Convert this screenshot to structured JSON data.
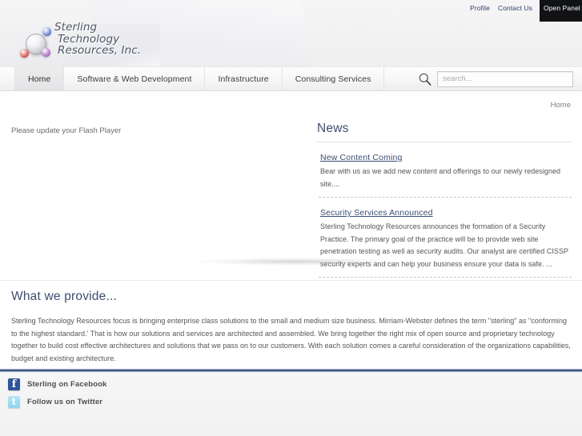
{
  "topnav": {
    "links": [
      {
        "label": "Profile"
      },
      {
        "label": "Contact Us"
      }
    ],
    "open_panel_label": "Open Panel"
  },
  "logo": {
    "line1": "Sterling",
    "line2": "Technology",
    "line3": "Resources, Inc.",
    "sphere_colors": {
      "main": "#d4d6db",
      "blue": "#3d50a8",
      "red": "#c63f3b",
      "purple": "#9b58b8"
    }
  },
  "nav": {
    "items": [
      {
        "label": "Home",
        "active": true
      },
      {
        "label": "Software & Web Development",
        "active": false
      },
      {
        "label": "Infrastructure",
        "active": false
      },
      {
        "label": "Consulting Services",
        "active": false
      }
    ]
  },
  "search": {
    "placeholder": "search...",
    "value": "",
    "icon": "search-icon"
  },
  "breadcrumb": {
    "current": "Home"
  },
  "content": {
    "flash_message": "Please update your Flash Player"
  },
  "news": {
    "heading": "News",
    "items": [
      {
        "title": "New Content Coming",
        "body": "Bear with us as we add new content and offerings to our newly redesigned site...."
      },
      {
        "title": "Security Services Announced",
        "body": "Sterling Technology Resources announces the formation of a Security Practice.  The primary goal of the practice will be to provide web site penetration testing as well as security audits.  Our analyst are certified CISSP security experts and can help your business ensure your data is safe.    ..."
      }
    ]
  },
  "provide": {
    "heading": "What we provide...",
    "body": "Sterling Technology Resources focus is bringing enterprise class solutions to the small and medium size business. Mirriam-Webster defines the term \"sterling\" as \"conforming to the highest standard.'  That is how our solutions and services are architected and assembled.  We bring together the right mix of open source and proprietary technology together to build cost effective architectures and solutions that we pass on to our customers.  With each solution comes a careful consideration of the organizations capabilities, budget and existing architecture."
  },
  "footer": {
    "social": [
      {
        "label": "Sterling on Facebook",
        "icon": "facebook-icon",
        "color": "#2f5596"
      },
      {
        "label": "Follow us on Twitter",
        "icon": "twitter-icon",
        "color": "#8fd3ee"
      }
    ],
    "divider_color": "#3f5a88"
  }
}
